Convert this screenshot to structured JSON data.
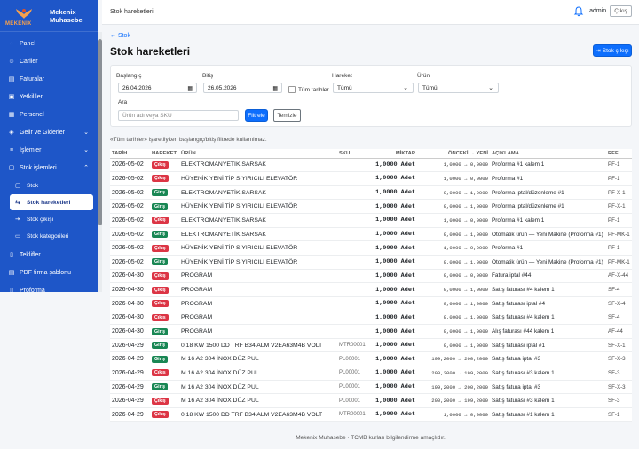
{
  "brand": {
    "logo_text": "MEKENIX",
    "name_line1": "Mekenix",
    "name_line2": "Muhasebe"
  },
  "sidebar": {
    "items": [
      {
        "label": "Panel",
        "icon": "speedometer-icon"
      },
      {
        "label": "Cariler",
        "icon": "people-icon"
      },
      {
        "label": "Faturalar",
        "icon": "receipt-icon"
      },
      {
        "label": "Yetkililer",
        "icon": "person-badge-icon"
      },
      {
        "label": "Personel",
        "icon": "id-card-icon"
      },
      {
        "label": "Gelir ve Giderler",
        "icon": "coins-icon"
      },
      {
        "label": "İşlemler",
        "icon": "list-icon"
      },
      {
        "label": "Stok işlemleri",
        "icon": "box-icon"
      }
    ],
    "sub_items": [
      {
        "label": "Stok",
        "icon": "box-icon"
      },
      {
        "label": "Stok hareketleri",
        "icon": "arrows-icon"
      },
      {
        "label": "Stok çıkışı",
        "icon": "box-arrow-icon"
      },
      {
        "label": "Stok kategorileri",
        "icon": "folder-icon"
      }
    ],
    "bottom_items": [
      {
        "label": "Teklifler",
        "icon": "document-icon"
      },
      {
        "label": "PDF firma şablonu",
        "icon": "pdf-icon"
      },
      {
        "label": "Proforma",
        "icon": "document-icon"
      }
    ]
  },
  "topbar": {
    "breadcrumb": "Stok hareketleri",
    "user": "admin",
    "logout": "Çıkış"
  },
  "page": {
    "back_link": "← Stok",
    "title": "Stok hareketleri",
    "stock_out_button": "Stok çıkışı",
    "note": "«Tüm tarihler» işaretliyken başlangıç/bitiş filtrede kullanılmaz."
  },
  "filters": {
    "start_label": "Başlangıç",
    "start_value": "26.04.2026",
    "end_label": "Bitiş",
    "end_value": "26.05.2026",
    "all_dates_label": "Tüm tarihler",
    "movement_label": "Hareket",
    "movement_value": "Tümü",
    "product_label": "Ürün",
    "product_value": "Tümü",
    "search_label": "Ara",
    "search_placeholder": "Ürün adı veya SKU",
    "filter_button": "Filtrele",
    "clear_button": "Temizle"
  },
  "table": {
    "headers": [
      "TARİH",
      "HAREKET",
      "ÜRÜN",
      "SKU",
      "MİKTAR",
      "ÖNCEKİ → YENİ",
      "AÇIKLAMA",
      "REF."
    ],
    "rows": [
      {
        "date": "2026-05-02",
        "type": "Çıkış",
        "dir": "out",
        "product": "ELEKTROMANYETİK SARSAK",
        "sku": "",
        "qty": "1,0000 Adet",
        "delta": "1,0000 → 0,0000",
        "desc": "Proforma #1 kalem 1",
        "ref": "PF-1"
      },
      {
        "date": "2026-05-02",
        "type": "Çıkış",
        "dir": "out",
        "product": "HÜYENİK YENİ TİP SIYIRICILI ELEVATÖR",
        "sku": "",
        "qty": "1,0000 Adet",
        "delta": "1,0000 → 0,0000",
        "desc": "Proforma #1",
        "ref": "PF-1"
      },
      {
        "date": "2026-05-02",
        "type": "Giriş",
        "dir": "in",
        "product": "ELEKTROMANYETİK SARSAK",
        "sku": "",
        "qty": "1,0000 Adet",
        "delta": "0,0000 → 1,0000",
        "desc": "Proforma iptal/düzenleme #1",
        "ref": "PF-X-1"
      },
      {
        "date": "2026-05-02",
        "type": "Giriş",
        "dir": "in",
        "product": "HÜYENİK YENİ TİP SIYIRICILI ELEVATÖR",
        "sku": "",
        "qty": "1,0000 Adet",
        "delta": "0,0000 → 1,0000",
        "desc": "Proforma iptal/düzenleme #1",
        "ref": "PF-X-1"
      },
      {
        "date": "2026-05-02",
        "type": "Çıkış",
        "dir": "out",
        "product": "ELEKTROMANYETİK SARSAK",
        "sku": "",
        "qty": "1,0000 Adet",
        "delta": "1,0000 → 0,0000",
        "desc": "Proforma #1 kalem 1",
        "ref": "PF-1"
      },
      {
        "date": "2026-05-02",
        "type": "Giriş",
        "dir": "in",
        "product": "ELEKTROMANYETİK SARSAK",
        "sku": "",
        "qty": "1,0000 Adet",
        "delta": "0,0000 → 1,0000",
        "desc": "Otomatik ürün — Yeni Makine (Proforma #1)",
        "ref": "PF-MK-1"
      },
      {
        "date": "2026-05-02",
        "type": "Çıkış",
        "dir": "out",
        "product": "HÜYENİK YENİ TİP SIYIRICILI ELEVATÖR",
        "sku": "",
        "qty": "1,0000 Adet",
        "delta": "1,0000 → 0,0000",
        "desc": "Proforma #1",
        "ref": "PF-1"
      },
      {
        "date": "2026-05-02",
        "type": "Giriş",
        "dir": "in",
        "product": "HÜYENİK YENİ TİP SIYIRICILI ELEVATÖR",
        "sku": "",
        "qty": "1,0000 Adet",
        "delta": "0,0000 → 1,0000",
        "desc": "Otomatik ürün — Yeni Makine (Proforma #1)",
        "ref": "PF-MK-1"
      },
      {
        "date": "2026-04-30",
        "type": "Çıkış",
        "dir": "out",
        "product": "PROGRAM",
        "sku": "",
        "qty": "1,0000 Adet",
        "delta": "0,0000 → 0,0000",
        "desc": "Fatura iptal #44",
        "ref": "AF-X-44"
      },
      {
        "date": "2026-04-30",
        "type": "Çıkış",
        "dir": "out",
        "product": "PROGRAM",
        "sku": "",
        "qty": "1,0000 Adet",
        "delta": "0,0000 → 1,0000",
        "desc": "Satış faturası #4 kalem 1",
        "ref": "SF-4"
      },
      {
        "date": "2026-04-30",
        "type": "Çıkış",
        "dir": "out",
        "product": "PROGRAM",
        "sku": "",
        "qty": "1,0000 Adet",
        "delta": "0,0000 → 1,0000",
        "desc": "Satış faturası iptal #4",
        "ref": "SF-X-4"
      },
      {
        "date": "2026-04-30",
        "type": "Çıkış",
        "dir": "out",
        "product": "PROGRAM",
        "sku": "",
        "qty": "1,0000 Adet",
        "delta": "0,0000 → 1,0000",
        "desc": "Satış faturası #4 kalem 1",
        "ref": "SF-4"
      },
      {
        "date": "2026-04-30",
        "type": "Giriş",
        "dir": "in",
        "product": "PROGRAM",
        "sku": "",
        "qty": "1,0000 Adet",
        "delta": "0,0000 → 1,0000",
        "desc": "Alış faturası #44 kalem 1",
        "ref": "AF-44"
      },
      {
        "date": "2026-04-29",
        "type": "Giriş",
        "dir": "in",
        "product": "0,18 KW 1500 DD TRF B34 ALM V2EA63M4B VOLT",
        "sku": "MTR00001",
        "qty": "1,0000 Adet",
        "delta": "0,0000 → 1,0000",
        "desc": "Satış faturası iptal #1",
        "ref": "SF-X-1"
      },
      {
        "date": "2026-04-29",
        "type": "Giriş",
        "dir": "in",
        "product": "M 16 A2 304 İNOX DÜZ PUL",
        "sku": "PL00001",
        "qty": "1,0000 Adet",
        "delta": "199,2000 → 200,2000",
        "desc": "Satış fatura iptal #3",
        "ref": "SF-X-3"
      },
      {
        "date": "2026-04-29",
        "type": "Çıkış",
        "dir": "out",
        "product": "M 16 A2 304 İNOX DÜZ PUL",
        "sku": "PL00001",
        "qty": "1,0000 Adet",
        "delta": "200,2000 → 199,2000",
        "desc": "Satış faturası #3 kalem 1",
        "ref": "SF-3"
      },
      {
        "date": "2026-04-29",
        "type": "Giriş",
        "dir": "in",
        "product": "M 16 A2 304 İNOX DÜZ PUL",
        "sku": "PL00001",
        "qty": "1,0000 Adet",
        "delta": "199,2000 → 200,2000",
        "desc": "Satış fatura iptal #3",
        "ref": "SF-X-3"
      },
      {
        "date": "2026-04-29",
        "type": "Çıkış",
        "dir": "out",
        "product": "M 16 A2 304 İNOX DÜZ PUL",
        "sku": "PL00001",
        "qty": "1,0000 Adet",
        "delta": "200,2000 → 199,2000",
        "desc": "Satış faturası #3 kalem 1",
        "ref": "SF-3"
      },
      {
        "date": "2026-04-29",
        "type": "Çıkış",
        "dir": "out",
        "product": "0,18 KW 1500 DD TRF B34 ALM V2EA63M4B VOLT",
        "sku": "MTR00001",
        "qty": "1,0000 Adet",
        "delta": "1,0000 → 0,0000",
        "desc": "Satış faturası #1 kalem 1",
        "ref": "SF-1"
      }
    ]
  },
  "footer": {
    "text": "Mekenix Muhasebe · TCMB kurları bilgilendirme amaçlıdır."
  },
  "colors": {
    "sidebar": "#1e56c8",
    "primary": "#0d6efd",
    "in": "#198754",
    "out": "#dc3545"
  }
}
